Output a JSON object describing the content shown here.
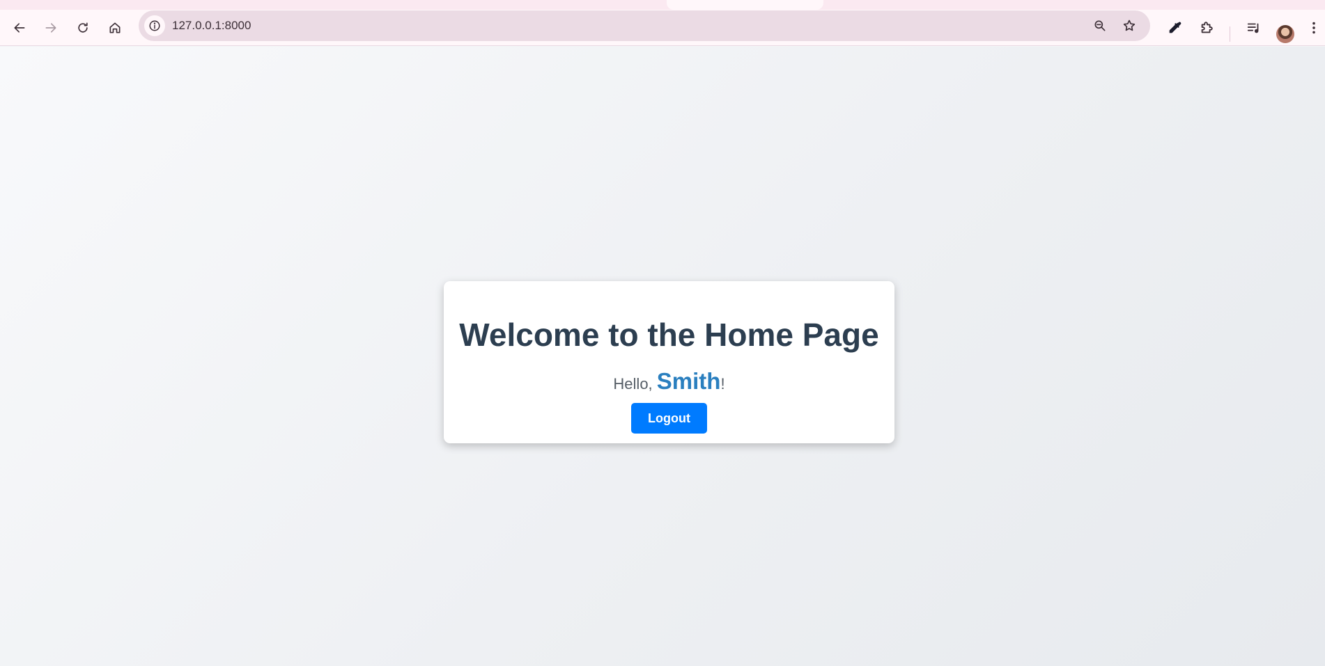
{
  "browser": {
    "url": "127.0.0.1:8000",
    "icons": {
      "back": "arrow-left-icon",
      "forward": "arrow-right-icon",
      "reload": "reload-icon",
      "home": "home-icon",
      "site_info": "info-icon",
      "zoom": "zoom-out-icon",
      "bookmark": "star-icon",
      "eyedropper": "eyedropper-icon",
      "extensions": "puzzle-icon",
      "media": "playlist-icon",
      "profile": "avatar",
      "menu": "kebab-menu-icon"
    }
  },
  "page": {
    "heading": "Welcome to the Home Page",
    "greeting_prefix": "Hello, ",
    "username": "Smith",
    "greeting_suffix": "!",
    "logout_label": "Logout"
  },
  "colors": {
    "heading": "#2c3e50",
    "username": "#2a7fbf",
    "button": "#007bff",
    "omnibox": "#ebdbe4"
  }
}
